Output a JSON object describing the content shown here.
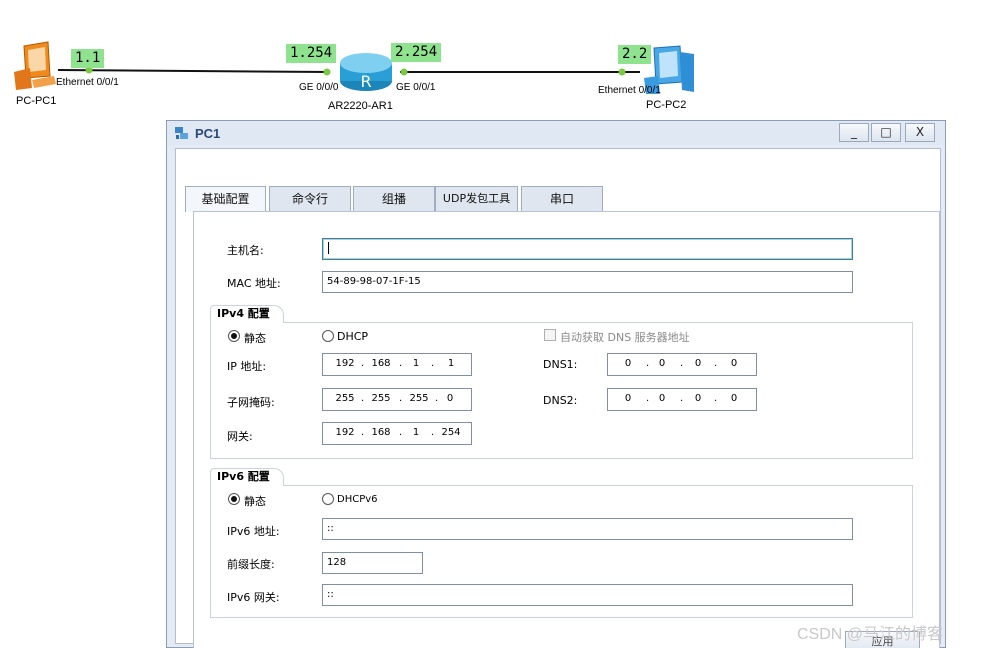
{
  "topology": {
    "pc1": {
      "name": "PC-PC1",
      "port": "Ethernet 0/0/1",
      "ip": "1.1"
    },
    "router": {
      "name": "AR2220-AR1",
      "left_port": "GE 0/0/0",
      "left_ip": "1.254",
      "right_port": "GE 0/0/1",
      "right_ip": "2.254"
    },
    "pc2": {
      "name": "PC-PC2",
      "port": "Ethernet 0/0/1",
      "ip": "2.2"
    }
  },
  "window": {
    "title": "PC1",
    "minimize": "_",
    "maximize": "□",
    "close": "X"
  },
  "tabs": [
    "基础配置",
    "命令行",
    "组播",
    "UDP发包工具",
    "串口"
  ],
  "basic": {
    "hostname_label": "主机名:",
    "hostname_value": "",
    "mac_label": "MAC 地址:",
    "mac_value": "54-89-98-07-1F-15"
  },
  "ipv4": {
    "group_title": "IPv4 配置",
    "static_label": "静态",
    "dhcp_label": "DHCP",
    "auto_dns_label": "自动获取 DNS 服务器地址",
    "ip_label": "IP 地址:",
    "ip": [
      "192",
      "168",
      "1",
      "1"
    ],
    "mask_label": "子网掩码:",
    "mask": [
      "255",
      "255",
      "255",
      "0"
    ],
    "gateway_label": "网关:",
    "gateway": [
      "192",
      "168",
      "1",
      "254"
    ],
    "dns1_label": "DNS1:",
    "dns1": [
      "0",
      "0",
      "0",
      "0"
    ],
    "dns2_label": "DNS2:",
    "dns2": [
      "0",
      "0",
      "0",
      "0"
    ]
  },
  "ipv6": {
    "group_title": "IPv6 配置",
    "static_label": "静态",
    "dhcp_label": "DHCPv6",
    "addr_label": "IPv6 地址:",
    "addr_value": "::",
    "prefix_label": "前缀长度:",
    "prefix_value": "128",
    "gateway_label": "IPv6 网关:",
    "gateway_value": "::"
  },
  "apply_label": "应用",
  "watermark": "CSDN @马江的博客",
  "colors": {
    "ip_tag": "#8fe38f",
    "link_dot": "#7ac943",
    "title_text": "#2b4a7a"
  }
}
